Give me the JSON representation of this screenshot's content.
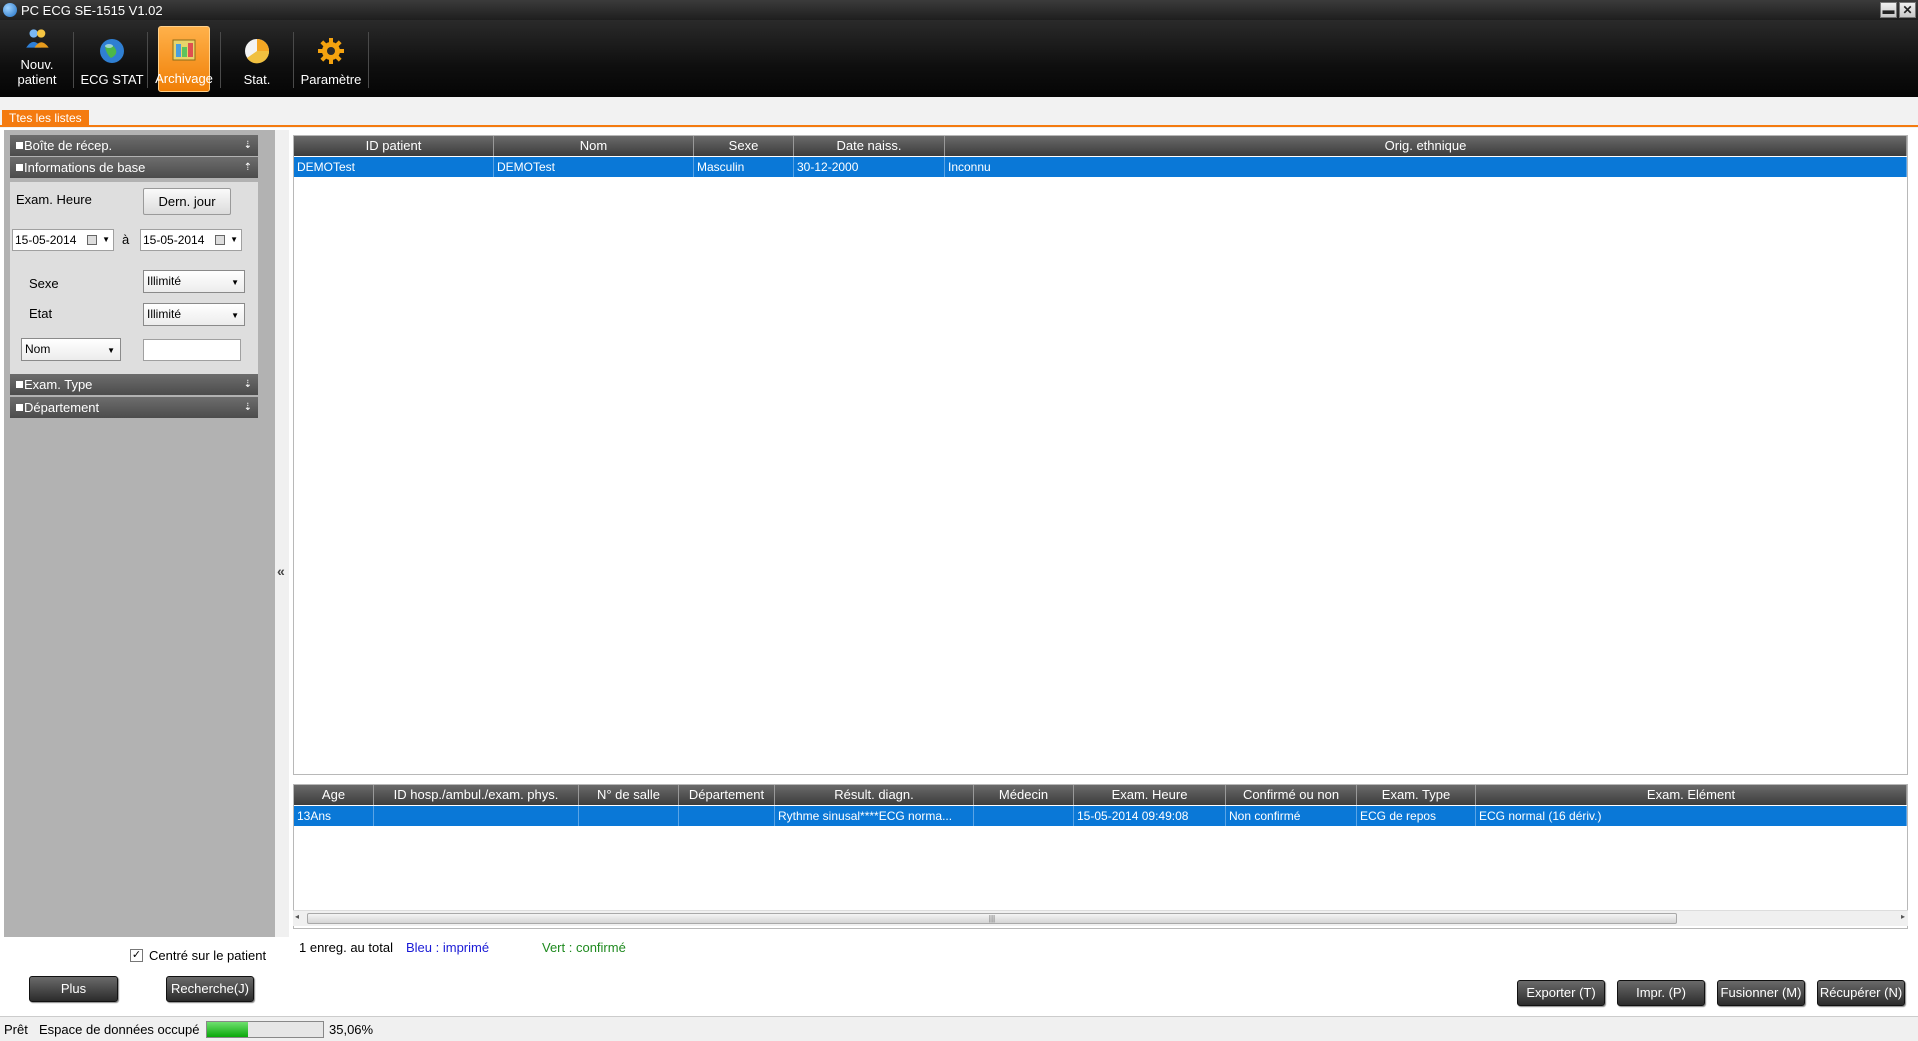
{
  "window": {
    "title": "PC ECG SE-1515 V1.02",
    "minimize_glyph": "▬",
    "close_glyph": "✕"
  },
  "toolbar": {
    "items": [
      {
        "label": "Nouv. patient",
        "icon": "users-icon"
      },
      {
        "label": "ECG STAT",
        "icon": "globe-icon"
      },
      {
        "label": "Archivage",
        "icon": "archive-icon",
        "active": true
      },
      {
        "label": "Stat.",
        "icon": "pie-chart-icon"
      },
      {
        "label": "Paramètre",
        "icon": "gear-icon"
      }
    ]
  },
  "tab": {
    "label": "Ttes les listes"
  },
  "left": {
    "sections": {
      "inbox": "Boîte de récep.",
      "basic": "Informations de base",
      "exam_type": "Exam. Type",
      "department": "Département"
    },
    "exam_time_label": "Exam. Heure",
    "last_day_button": "Dern. jour",
    "date_from": "15-05-2014",
    "date_sep": "à",
    "date_to": "15-05-2014",
    "sex_label": "Sexe",
    "sex_value": "Illimité",
    "state_label": "Etat",
    "state_value": "Illimité",
    "field_select": "Nom",
    "field_value": "",
    "centered_label": "Centré sur le patient",
    "centered_checked": "✓",
    "more_button": "Plus",
    "search_button": "Recherche(J)",
    "collapse_glyph": "«"
  },
  "patients": {
    "columns": [
      "ID patient",
      "Nom",
      "Sexe",
      "Date naiss.",
      "Orig. ethnique"
    ],
    "rows": [
      [
        "DEMOTest",
        "DEMOTest",
        "Masculin",
        "30-12-2000",
        "Inconnu"
      ]
    ]
  },
  "exams": {
    "columns": [
      "Age",
      "ID hosp./ambul./exam. phys.",
      "N° de salle",
      "Département",
      "Résult. diagn.",
      "Médecin",
      "Exam. Heure",
      "Confirmé ou non",
      "Exam. Type",
      "Exam. Elément"
    ],
    "rows": [
      [
        "13Ans",
        "",
        "",
        "",
        "Rythme sinusal****ECG norma...",
        "",
        "15-05-2014 09:49:08",
        "Non confirmé",
        "ECG de repos",
        "ECG normal (16 dériv.)"
      ]
    ]
  },
  "scrollbar": {
    "left": "◂",
    "right": "▸",
    "grip": "|||"
  },
  "legend": {
    "count": "1 enreg. au total",
    "blue": "Bleu : imprimé",
    "green": "Vert : confirmé",
    "blue_color": "#1a1ad6",
    "green_color": "#1f8a1f"
  },
  "actions": {
    "export": "Exporter (T)",
    "print": "Impr. (P)",
    "merge": "Fusionner (M)",
    "retrieve": "Récupérer (N)"
  },
  "status": {
    "ready": "Prêt",
    "space_label": "Espace de données occupé",
    "space_value": "35,06%",
    "space_fraction": 0.3506
  }
}
